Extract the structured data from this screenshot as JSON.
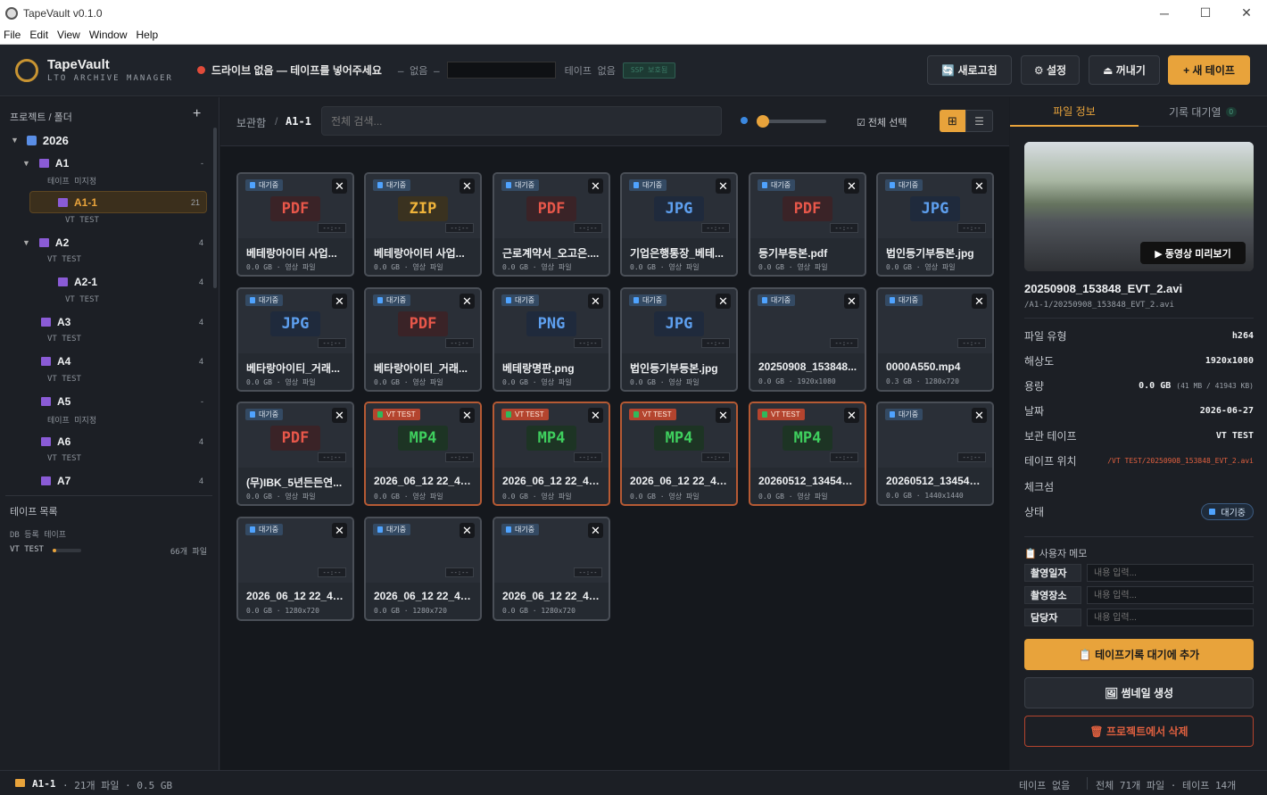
{
  "window": {
    "title": "TapeVault v0.1.0",
    "min": "─",
    "max": "☐",
    "close": "✕"
  },
  "menu": [
    "File",
    "Edit",
    "View",
    "Window",
    "Help"
  ],
  "header": {
    "app_name": "TapeVault",
    "app_sub": "LTO ARCHIVE MANAGER",
    "drive_status": "드라이브 없음 — 테이프를 넣어주세요",
    "drive_none": "– 없음 –",
    "tape_none": "테이프 없음",
    "ssp": "SSP 보호됨",
    "btn_refresh": "🔄 새로고침",
    "btn_settings": "⚙ 설정",
    "btn_eject": "⏏ 꺼내기",
    "btn_new_tape": "+ 새 테이프",
    "accent": "#e8a33b",
    "drive_dot_color": "#e04b3a"
  },
  "sidebar": {
    "projects_title": "프로젝트 / 폴더",
    "add": "+",
    "year": "2026",
    "nodes": [
      {
        "name": "A1",
        "sub": "테이프 미지정",
        "count": "-"
      },
      {
        "name": "A1-1",
        "sub": "VT TEST",
        "count": "21"
      },
      {
        "name": "A2",
        "sub": "VT TEST",
        "count": "4"
      },
      {
        "name": "A2-1",
        "sub": "VT TEST",
        "count": "4"
      },
      {
        "name": "A3",
        "sub": "VT TEST",
        "count": "4"
      },
      {
        "name": "A4",
        "sub": "VT TEST",
        "count": "4"
      },
      {
        "name": "A5",
        "sub": "테이프 미지정",
        "count": "-"
      },
      {
        "name": "A6",
        "sub": "VT TEST",
        "count": "4"
      },
      {
        "name": "A7",
        "sub": "",
        "count": "4"
      }
    ],
    "tapes_title": "테이프 목록",
    "db_tapes": "DB 등록 테이프",
    "tape_name": "VT TEST",
    "tape_files": "66개 파일"
  },
  "toolbar": {
    "crumb_root": "보관함",
    "crumb_sep": "/",
    "crumb_current": "A1-1",
    "search_placeholder": "전체 검색...",
    "select_all": "☑ 전체 선택",
    "grid_icon": "⊞",
    "list_icon": "☰"
  },
  "files": [
    {
      "ext": "PDF",
      "name": "베테랑아이터 사업...",
      "meta": "0.0 GB · 영상 파일",
      "badge": "대기중",
      "vt": false,
      "thumb": "ext"
    },
    {
      "ext": "ZIP",
      "name": "베테랑아이터 사업...",
      "meta": "0.0 GB · 영상 파일",
      "badge": "대기중",
      "vt": false,
      "thumb": "ext"
    },
    {
      "ext": "PDF",
      "name": "근로계약서_오고은....",
      "meta": "0.0 GB · 영상 파일",
      "badge": "대기중",
      "vt": false,
      "thumb": "ext"
    },
    {
      "ext": "JPG",
      "name": "기업은행통장_베테...",
      "meta": "0.0 GB · 영상 파일",
      "badge": "대기중",
      "vt": false,
      "thumb": "ext"
    },
    {
      "ext": "PDF",
      "name": "등기부등본.pdf",
      "meta": "0.0 GB · 영상 파일",
      "badge": "대기중",
      "vt": false,
      "thumb": "ext"
    },
    {
      "ext": "JPG",
      "name": "법인등기부등본.jpg",
      "meta": "0.0 GB · 영상 파일",
      "badge": "대기중",
      "vt": false,
      "thumb": "ext"
    },
    {
      "ext": "JPG",
      "name": "베타랑아이티_거래...",
      "meta": "0.0 GB · 영상 파일",
      "badge": "대기중",
      "vt": false,
      "thumb": "ext"
    },
    {
      "ext": "PDF",
      "name": "베타랑아이티_거래...",
      "meta": "0.0 GB · 영상 파일",
      "badge": "대기중",
      "vt": false,
      "thumb": "ext"
    },
    {
      "ext": "PNG",
      "name": "베테랑명판.png",
      "meta": "0.0 GB · 영상 파일",
      "badge": "대기중",
      "vt": false,
      "thumb": "ext"
    },
    {
      "ext": "JPG",
      "name": "법인등기부등본.jpg",
      "meta": "0.0 GB · 영상 파일",
      "badge": "대기중",
      "vt": false,
      "thumb": "ext"
    },
    {
      "ext": "",
      "name": "20250908_153848...",
      "meta": "0.0 GB · 1920x1080",
      "badge": "대기중",
      "vt": false,
      "thumb": "road"
    },
    {
      "ext": "",
      "name": "0000A550.mp4",
      "meta": "0.3 GB · 1280x720",
      "badge": "대기중",
      "vt": false,
      "thumb": "stage"
    },
    {
      "ext": "PDF",
      "name": "(무)IBK_5년든든연...",
      "meta": "0.0 GB · 영상 파일",
      "badge": "대기중",
      "vt": false,
      "thumb": "ext"
    },
    {
      "ext": "MP4",
      "name": "2026_06_12 22_41 ...",
      "meta": "0.0 GB · 영상 파일",
      "badge": "VT TEST",
      "vt": true,
      "thumb": "ext"
    },
    {
      "ext": "MP4",
      "name": "2026_06_12 22_41 ...",
      "meta": "0.0 GB · 영상 파일",
      "badge": "VT TEST",
      "vt": true,
      "thumb": "ext"
    },
    {
      "ext": "MP4",
      "name": "2026_06_12 22_41 ...",
      "meta": "0.0 GB · 영상 파일",
      "badge": "VT TEST",
      "vt": true,
      "thumb": "ext"
    },
    {
      "ext": "MP4",
      "name": "20260512_134546....",
      "meta": "0.0 GB · 영상 파일",
      "badge": "VT TEST",
      "vt": true,
      "thumb": "ext"
    },
    {
      "ext": "",
      "name": "20260512_134546....",
      "meta": "0.0 GB · 1440x1440",
      "badge": "대기중",
      "vt": false,
      "thumb": "black"
    },
    {
      "ext": "",
      "name": "2026_06_12 22_41 ...",
      "meta": "0.0 GB · 1280x720",
      "badge": "대기중",
      "vt": false,
      "thumb": "fire"
    },
    {
      "ext": "",
      "name": "2026_06_12 22_41 ...",
      "meta": "0.0 GB · 1280x720",
      "badge": "대기중",
      "vt": false,
      "thumb": "fire"
    },
    {
      "ext": "",
      "name": "2026_06_12 22_41 ...",
      "meta": "0.0 GB · 1280x720",
      "badge": "대기중",
      "vt": false,
      "thumb": "fire"
    }
  ],
  "card_close": "✕",
  "card_duration": "--:--",
  "ext_colors": {
    "PDF": {
      "fg": "#e8574a",
      "bg": "#3a2327"
    },
    "ZIP": {
      "fg": "#f0b43a",
      "bg": "#3a3220"
    },
    "JPG": {
      "fg": "#5ea0f0",
      "bg": "#1f2a3c"
    },
    "PNG": {
      "fg": "#5ea0f0",
      "bg": "#1f2a3c"
    },
    "MP4": {
      "fg": "#3fcf5e",
      "bg": "#1d3424"
    }
  },
  "right": {
    "tab_info": "파일 정보",
    "tab_queue": "기록 대기열",
    "queue_count": "0",
    "preview_btn": "▶ 동영상 미리보기",
    "filename": "20250908_153848_EVT_2.avi",
    "path": "/A1-1/20250908_153848_EVT_2.avi",
    "props": [
      {
        "k": "파일 유형",
        "v": "h264"
      },
      {
        "k": "해상도",
        "v": "1920x1080"
      },
      {
        "k": "용량",
        "v": "0.0 GB",
        "v2": "(41 MB / 41943 KB)"
      },
      {
        "k": "날짜",
        "v": "2026-06-27"
      },
      {
        "k": "보관 테이프",
        "v": "VT TEST"
      },
      {
        "k": "테이프 위치",
        "v": "/VT TEST/20250908_153848_EVT_2.avi"
      },
      {
        "k": "체크섬",
        "v": ""
      },
      {
        "k": "상태",
        "v": "대기중"
      }
    ],
    "memo_title": "📋 사용자 메모",
    "memo": [
      {
        "label": "촬영일자",
        "placeholder": "내용 입력..."
      },
      {
        "label": "촬영장소",
        "placeholder": "내용 입력..."
      },
      {
        "label": "담당자",
        "placeholder": "내용 입력..."
      }
    ],
    "btn_add_queue": "📋 테이프기록 대기에 추가",
    "btn_thumb": "🖼 썸네일 생성",
    "btn_delete": "🗑 프로젝트에서 삭제"
  },
  "status": {
    "folder": "A1-1",
    "summary": "· 21개 파일 · 0.5 GB",
    "tape": "테이프 없음",
    "totals": "전체 71개 파일 · 테이프 14개"
  }
}
